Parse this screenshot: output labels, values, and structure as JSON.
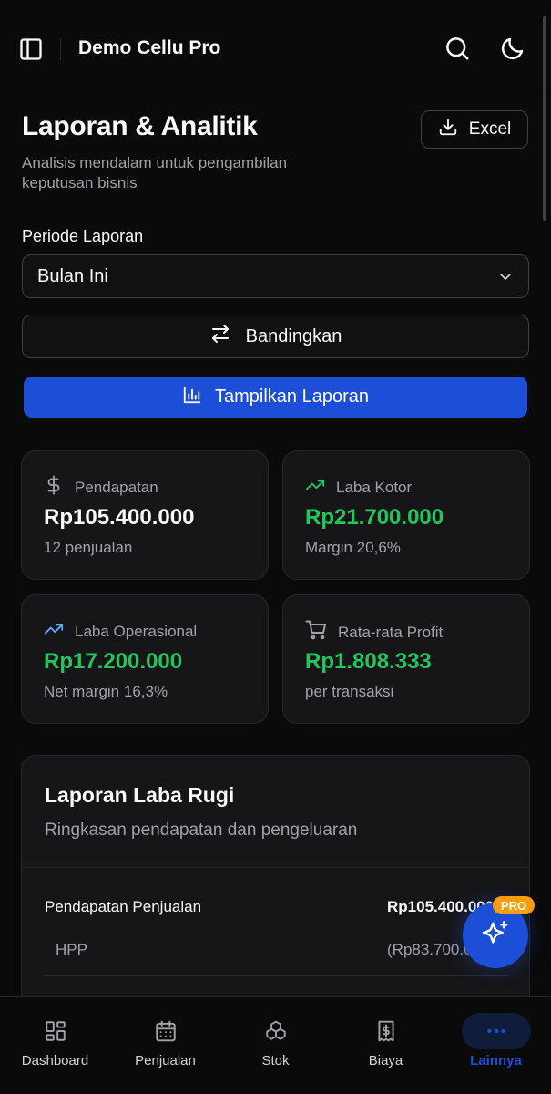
{
  "header": {
    "app_title": "Demo Cellu Pro",
    "icons": [
      "sidebar-toggle-icon",
      "search-icon",
      "moon-icon"
    ]
  },
  "page": {
    "title": "Laporan & Analitik",
    "subtitle": "Analisis mendalam untuk pengambilan keputusan bisnis",
    "export_label": "Excel"
  },
  "filters": {
    "period_label": "Periode Laporan",
    "period_value": "Bulan Ini",
    "compare_label": "Bandingkan",
    "show_label": "Tampilkan Laporan"
  },
  "stats": [
    {
      "label": "Pendapatan",
      "value": "Rp105.400.000",
      "note": "12 penjualan",
      "icon": "dollar-icon"
    },
    {
      "label": "Laba Kotor",
      "value": "Rp21.700.000",
      "note": "Margin 20,6%",
      "icon": "trending-up-icon"
    },
    {
      "label": "Laba Operasional",
      "value": "Rp17.200.000",
      "note": "Net margin 16,3%",
      "icon": "trending-up-icon"
    },
    {
      "label": "Rata-rata Profit",
      "value": "Rp1.808.333",
      "note": "per transaksi",
      "icon": "cart-icon"
    }
  ],
  "profit_loss": {
    "title": "Laporan Laba Rugi",
    "description": "Ringkasan pendapatan dan pengeluaran",
    "rows": [
      {
        "label": "Pendapatan Penjualan",
        "amount": "Rp105.400.000"
      },
      {
        "label": "HPP",
        "amount": "(Rp83.700.000)"
      }
    ]
  },
  "fab": {
    "badge": "PRO",
    "icon": "sparkles-icon"
  },
  "nav": [
    {
      "label": "Dashboard",
      "icon": "dashboard-icon",
      "active": false
    },
    {
      "label": "Penjualan",
      "icon": "calendar-icon",
      "active": false
    },
    {
      "label": "Stok",
      "icon": "boxes-icon",
      "active": false
    },
    {
      "label": "Biaya",
      "icon": "receipt-icon",
      "active": false
    },
    {
      "label": "Lainnya",
      "icon": "more-icon",
      "active": true
    }
  ],
  "colors": {
    "background": "#0a0a0a",
    "card": "#161618",
    "accent": "#1d4ed8",
    "positive": "#22c55e",
    "badge": "#f59e0b"
  }
}
